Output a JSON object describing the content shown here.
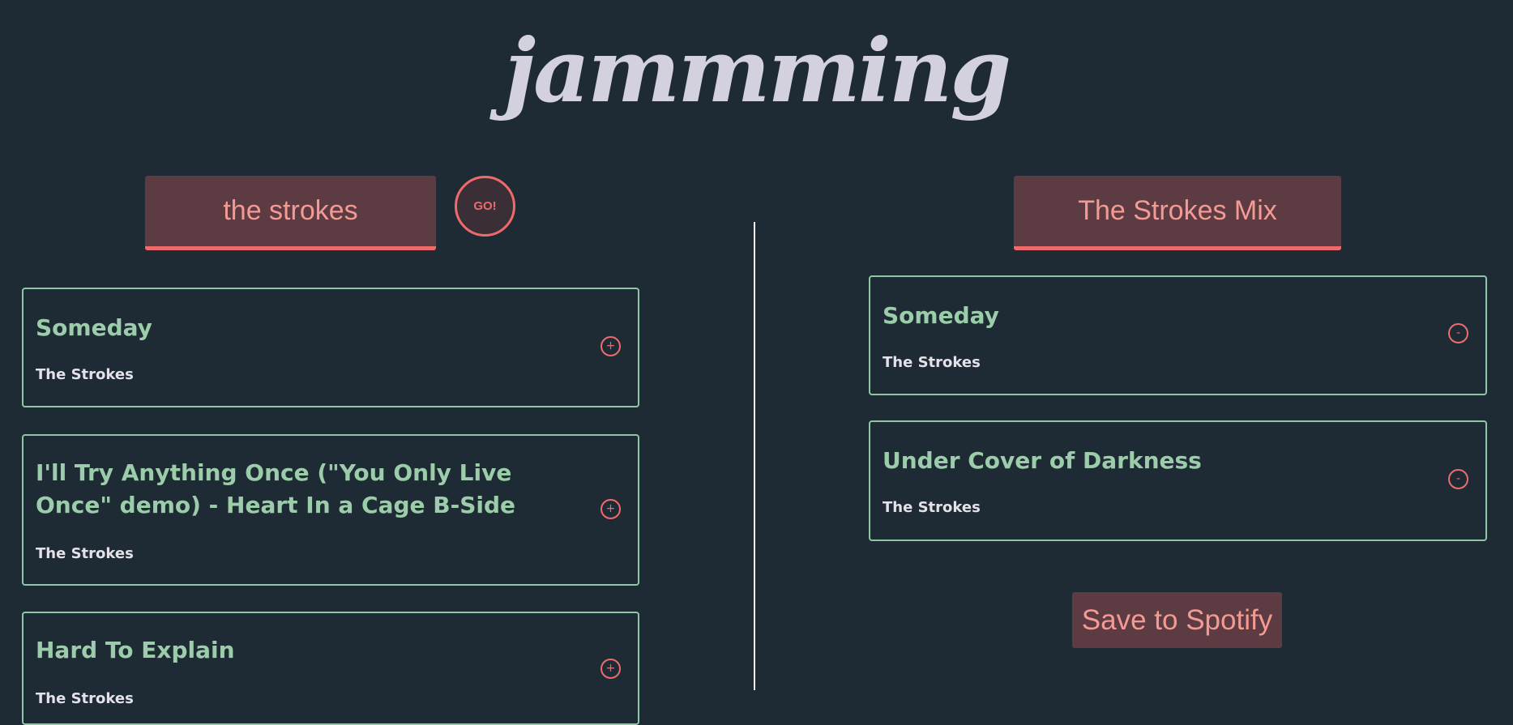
{
  "app": {
    "title": "jammming"
  },
  "search": {
    "value": "the strokes",
    "button_label": "GO!"
  },
  "results": [
    {
      "title": "Someday",
      "artist": "The Strokes",
      "action": "+"
    },
    {
      "title": "I'll Try Anything Once (\"You Only Live Once\" demo) - Heart In a Cage B-Side",
      "artist": "The Strokes",
      "action": "+"
    },
    {
      "title": "Hard To Explain",
      "artist": "The Strokes",
      "action": "+"
    }
  ],
  "playlist": {
    "name": "The Strokes Mix",
    "tracks": [
      {
        "title": "Someday",
        "artist": "The Strokes",
        "action": "-"
      },
      {
        "title": "Under Cover of Darkness",
        "artist": "The Strokes",
        "action": "-"
      }
    ],
    "save_label": "Save to Spotify"
  },
  "colors": {
    "background": "#1f2b34",
    "accent": "#ef6b6b",
    "track_title": "#9ccdaa",
    "card_border": "#8fc7a6",
    "input_bg": "#5c3b42"
  }
}
